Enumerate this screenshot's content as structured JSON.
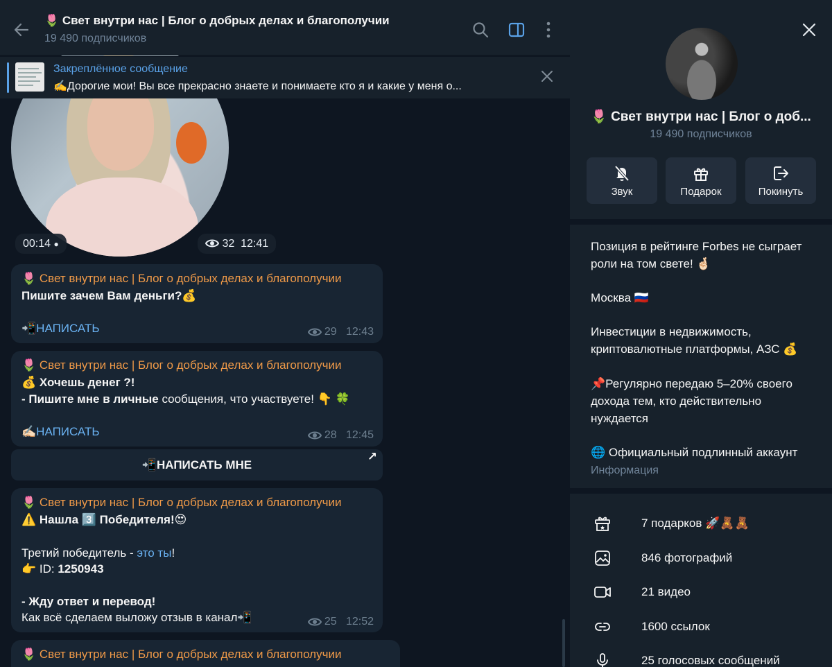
{
  "chat": {
    "title": "🌷 Свет внутри нас | Блог о добрых делах и благополучии",
    "subscribers": "19 490 подписчиков",
    "pinned": {
      "title": "Закреплённое сообщение",
      "text": "✍️Дорогие мои! Вы все прекрасно знаете и понимаете кто я и какие у меня о..."
    },
    "video": {
      "duration": "00:14",
      "views": "32",
      "time": "12:41"
    },
    "messages": [
      {
        "sender": "🌷 Свет внутри нас | Блог о добрых делах и благополучии",
        "line1": "Пишите зачем Вам деньги?💰",
        "link": "📲НАПИСАТЬ",
        "views": "29",
        "time": "12:43"
      },
      {
        "sender": "🌷 Свет внутри нас | Блог о добрых делах и благополучии",
        "line1": "💰 Хочешь денег ?!",
        "line2_bold": "- Пишите мне в личные",
        "line2_rest": " сообщения, что участвуете! 👇 🍀",
        "link": "✍🏻НАПИСАТЬ",
        "views": "28",
        "time": "12:45",
        "button": "📲НАПИСАТЬ МНЕ",
        "button_arrow": "↗"
      },
      {
        "sender": "🌷 Свет внутри нас | Блог о добрых делах и благополучии",
        "line1": "⚠️ Нашла 3️⃣ Победителя!😍",
        "line2_pre": "Третий победитель - ",
        "line2_link": "это ты",
        "line2_post": "!",
        "line3_pre": "👉 ID:  ",
        "line3_id": "1250943",
        "line4": "- Жду ответ и перевод!",
        "line5": "Как всё сделаем выложу отзыв в канал📲",
        "views": "25",
        "time": "12:52"
      },
      {
        "sender": "🌷 Свет внутри нас | Блог о добрых делах и благополучии"
      }
    ]
  },
  "panel": {
    "title": "🌷 Свет внутри нас | Блог о доб...",
    "subscribers": "19 490 подписчиков",
    "actions": [
      "Звук",
      "Подарок",
      "Покинуть"
    ],
    "about": [
      "Позиция в рейтинге Forbes не сыграет",
      "роли на том свете! 🤞🏻",
      "Москва 🇷🇺",
      "Инвестиции в недвижимость,",
      "криптовалютные платформы, АЗС 💰",
      "📌Регулярно передаю 5–20% своего",
      "дохода тем, кто действительно",
      "нуждается",
      "🌐 Официальный подлинный аккаунт"
    ],
    "about_caption": "Информация",
    "media": [
      "7 подарков 🚀🧸🧸",
      "846 фотографий",
      "21 видео",
      "1600 ссылок",
      "25 голосовых сообщений"
    ]
  },
  "colors": {
    "accent": "#5aa2e8",
    "sender": "#f09a48",
    "bubble": "#182533",
    "background": "#0e1621"
  }
}
